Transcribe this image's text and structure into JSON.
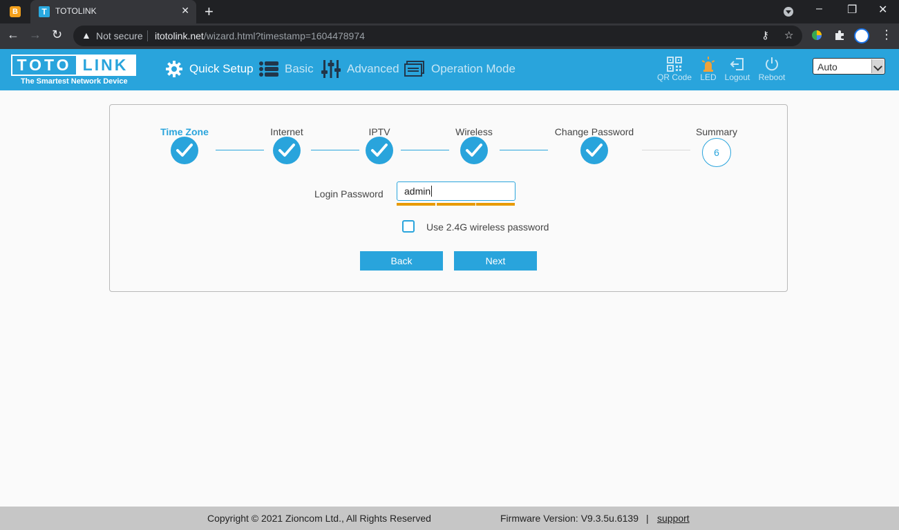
{
  "browser": {
    "tab_title": "TOTOLINK",
    "security_label": "Not secure",
    "url_host": "itotolink.net",
    "url_path": "/wizard.html?timestamp=1604478974"
  },
  "header": {
    "logo_left": "TOTO",
    "logo_right": "LINK",
    "tagline": "The Smartest Network Device",
    "nav": {
      "quick_setup": "Quick Setup",
      "basic": "Basic",
      "advanced": "Advanced",
      "operation_mode": "Operation Mode"
    },
    "tools": {
      "qr_code": "QR Code",
      "led": "LED",
      "logout": "Logout",
      "reboot": "Reboot"
    },
    "language": "Auto",
    "colors": {
      "primary": "#29a4dc",
      "led_active": "#f0a23a",
      "strength_bar": "#e89a00"
    }
  },
  "wizard": {
    "steps": [
      {
        "label": "Time Zone",
        "status": "done",
        "current": true
      },
      {
        "label": "Internet",
        "status": "done"
      },
      {
        "label": "IPTV",
        "status": "done"
      },
      {
        "label": "Wireless",
        "status": "done"
      },
      {
        "label": "Change Password",
        "status": "done"
      },
      {
        "label": "Summary",
        "status": "pending",
        "number": "6"
      }
    ],
    "password_label": "Login Password",
    "password_value": "admin",
    "password_strength_segments": 3,
    "checkbox_label": "Use 2.4G wireless password",
    "checkbox_checked": false,
    "back_label": "Back",
    "next_label": "Next"
  },
  "footer": {
    "copyright": "Copyright © 2021 Zioncom Ltd., All Rights Reserved",
    "firmware": "Firmware Version: V9.3.5u.6139",
    "separator": "|",
    "support": "support"
  }
}
